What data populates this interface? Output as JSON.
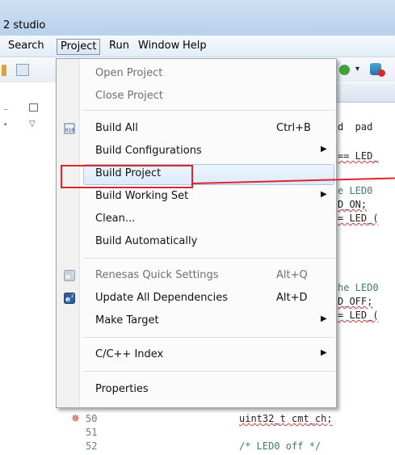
{
  "window": {
    "title": "2 studio"
  },
  "menubar": {
    "items": [
      {
        "label": "Search"
      },
      {
        "label": "Project",
        "open": true
      },
      {
        "label": "Run"
      },
      {
        "label": "Window"
      },
      {
        "label": "Help"
      }
    ]
  },
  "project_menu": {
    "items": [
      {
        "label": "Open Project",
        "enabled": false
      },
      {
        "label": "Close Project",
        "enabled": false
      },
      {
        "label": "Build All",
        "accelerator": "Ctrl+B",
        "icon": "build-all-icon"
      },
      {
        "label": "Build Configurations",
        "submenu": true
      },
      {
        "label": "Build Project",
        "highlighted": true
      },
      {
        "label": "Build Working Set",
        "submenu": true
      },
      {
        "label": "Clean..."
      },
      {
        "label": "Build Automatically"
      },
      {
        "label": "Renesas Quick Settings",
        "accelerator": "Alt+Q",
        "enabled": false,
        "icon": "e2-icon"
      },
      {
        "label": "Update All Dependencies",
        "accelerator": "Alt+D",
        "icon": "e2-icon"
      },
      {
        "label": "Make Target",
        "submenu": true
      },
      {
        "label": "C/C++ Index",
        "submenu": true
      },
      {
        "label": "Properties"
      }
    ]
  },
  "editor": {
    "line_numbers": [
      "50",
      "51",
      "52"
    ],
    "code_right": [
      "d  pad",
      "== LED_",
      "e LED0 ",
      "D_ON;",
      "= LED_(",
      "he LED0",
      "D_OFF;",
      "= LED_("
    ],
    "code_bottom": [
      "uint32_t cmt_ch;",
      "/* LED0 off */"
    ]
  },
  "colors": {
    "annotation": "#e0242c",
    "highlight": "#dcebfb"
  }
}
